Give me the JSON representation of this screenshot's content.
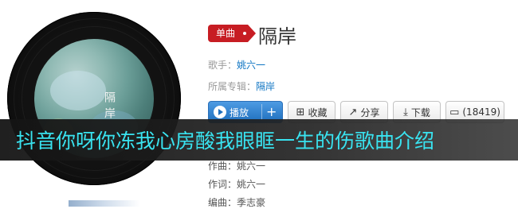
{
  "song": {
    "tag": "单曲",
    "title": "隔岸",
    "singer_label": "歌手：",
    "singer": "姚六一",
    "album_label": "所属专辑：",
    "album": "隔岸"
  },
  "cover": {
    "title": "隔岸"
  },
  "actions": {
    "play": "播放",
    "add": "+",
    "favorite": "收藏",
    "share": "分享",
    "download": "下载",
    "comments": "(18419)"
  },
  "banner": {
    "text": "抖音你呀你冻我心房酸我眼眶一生的伤歌曲介绍"
  },
  "credits": {
    "composer": "作曲：姚六一",
    "lyricist": "作词：姚六一",
    "arranger": "编曲：季志豪"
  },
  "colors": {
    "tag_red": "#c71d23",
    "link_blue": "#0c73c2",
    "play_blue": "#1f6fbd",
    "banner_text": "#39e3f0"
  },
  "icons": {
    "favorite": "folder-plus-icon",
    "share": "share-icon",
    "download": "download-icon",
    "comment": "comment-icon",
    "play": "play-icon"
  }
}
